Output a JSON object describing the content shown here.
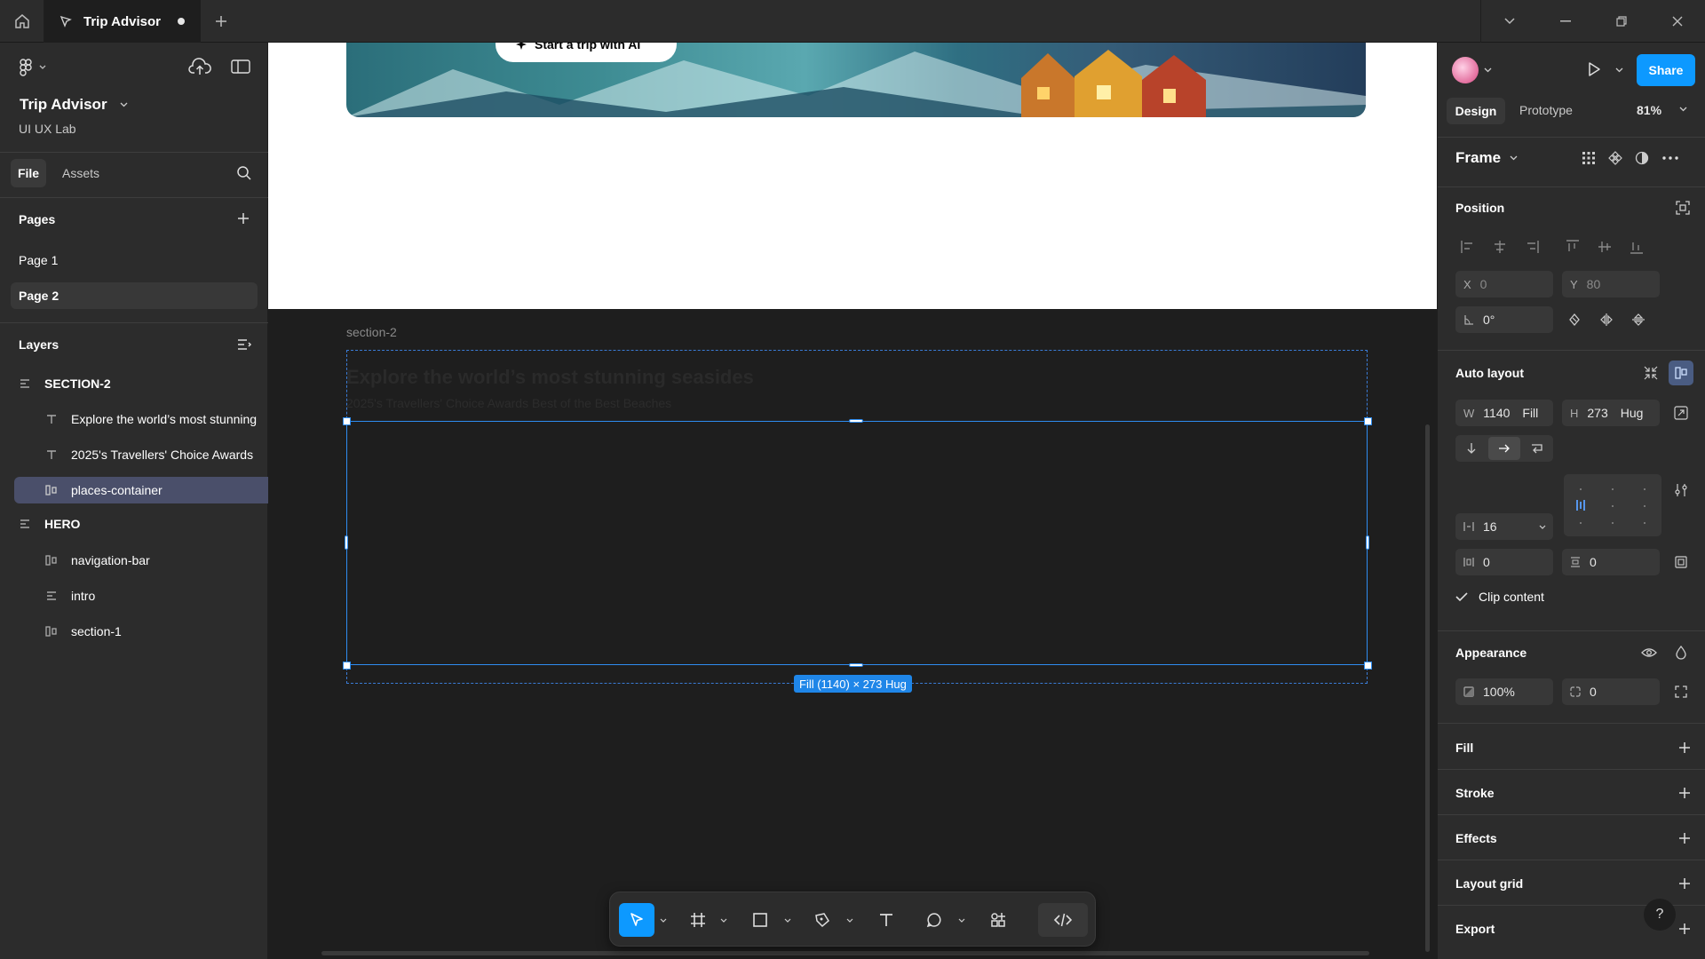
{
  "titlebar": {
    "tab_title": "Trip Advisor"
  },
  "left": {
    "project_title": "Trip Advisor",
    "team": "UI UX Lab",
    "tabs": {
      "file": "File",
      "assets": "Assets"
    },
    "pages_label": "Pages",
    "pages": [
      "Page 1",
      "Page 2"
    ],
    "layers_label": "Layers",
    "layers": [
      {
        "name": "SECTION-2",
        "type": "section"
      },
      {
        "name": "Explore the world’s most stunning",
        "type": "text"
      },
      {
        "name": "2025's Travellers' Choice Awards",
        "type": "text"
      },
      {
        "name": "places-container",
        "type": "autolayout"
      },
      {
        "name": "HERO",
        "type": "section"
      },
      {
        "name": "navigation-bar",
        "type": "autolayout"
      },
      {
        "name": "intro",
        "type": "section"
      },
      {
        "name": "section-1",
        "type": "autolayout"
      }
    ]
  },
  "canvas": {
    "ai_pill": "Start a trip with AI",
    "frame_label": "section-2",
    "heading": "Explore the world’s most stunning seasides",
    "subheading": "2025's Travellers' Choice Awards Best of the Best Beaches",
    "size_badge": "Fill (1140) × 273 Hug"
  },
  "right": {
    "share": "Share",
    "tabs": {
      "design": "Design",
      "prototype": "Prototype"
    },
    "zoom": "81%",
    "frame": "Frame",
    "position_label": "Position",
    "x_label": "X",
    "x_value": "0",
    "y_label": "Y",
    "y_value": "80",
    "rotation": "0°",
    "autolayout_label": "Auto layout",
    "w_label": "W",
    "w_value": "1140",
    "w_mode": "Fill",
    "h_label": "H",
    "h_value": "273",
    "h_mode": "Hug",
    "gap": "16",
    "padding_h": "0",
    "padding_v": "0",
    "clip_content": "Clip content",
    "appearance_label": "Appearance",
    "opacity": "100%",
    "radius": "0",
    "sections": [
      "Fill",
      "Stroke",
      "Effects",
      "Layout grid",
      "Export"
    ],
    "help": "?"
  }
}
